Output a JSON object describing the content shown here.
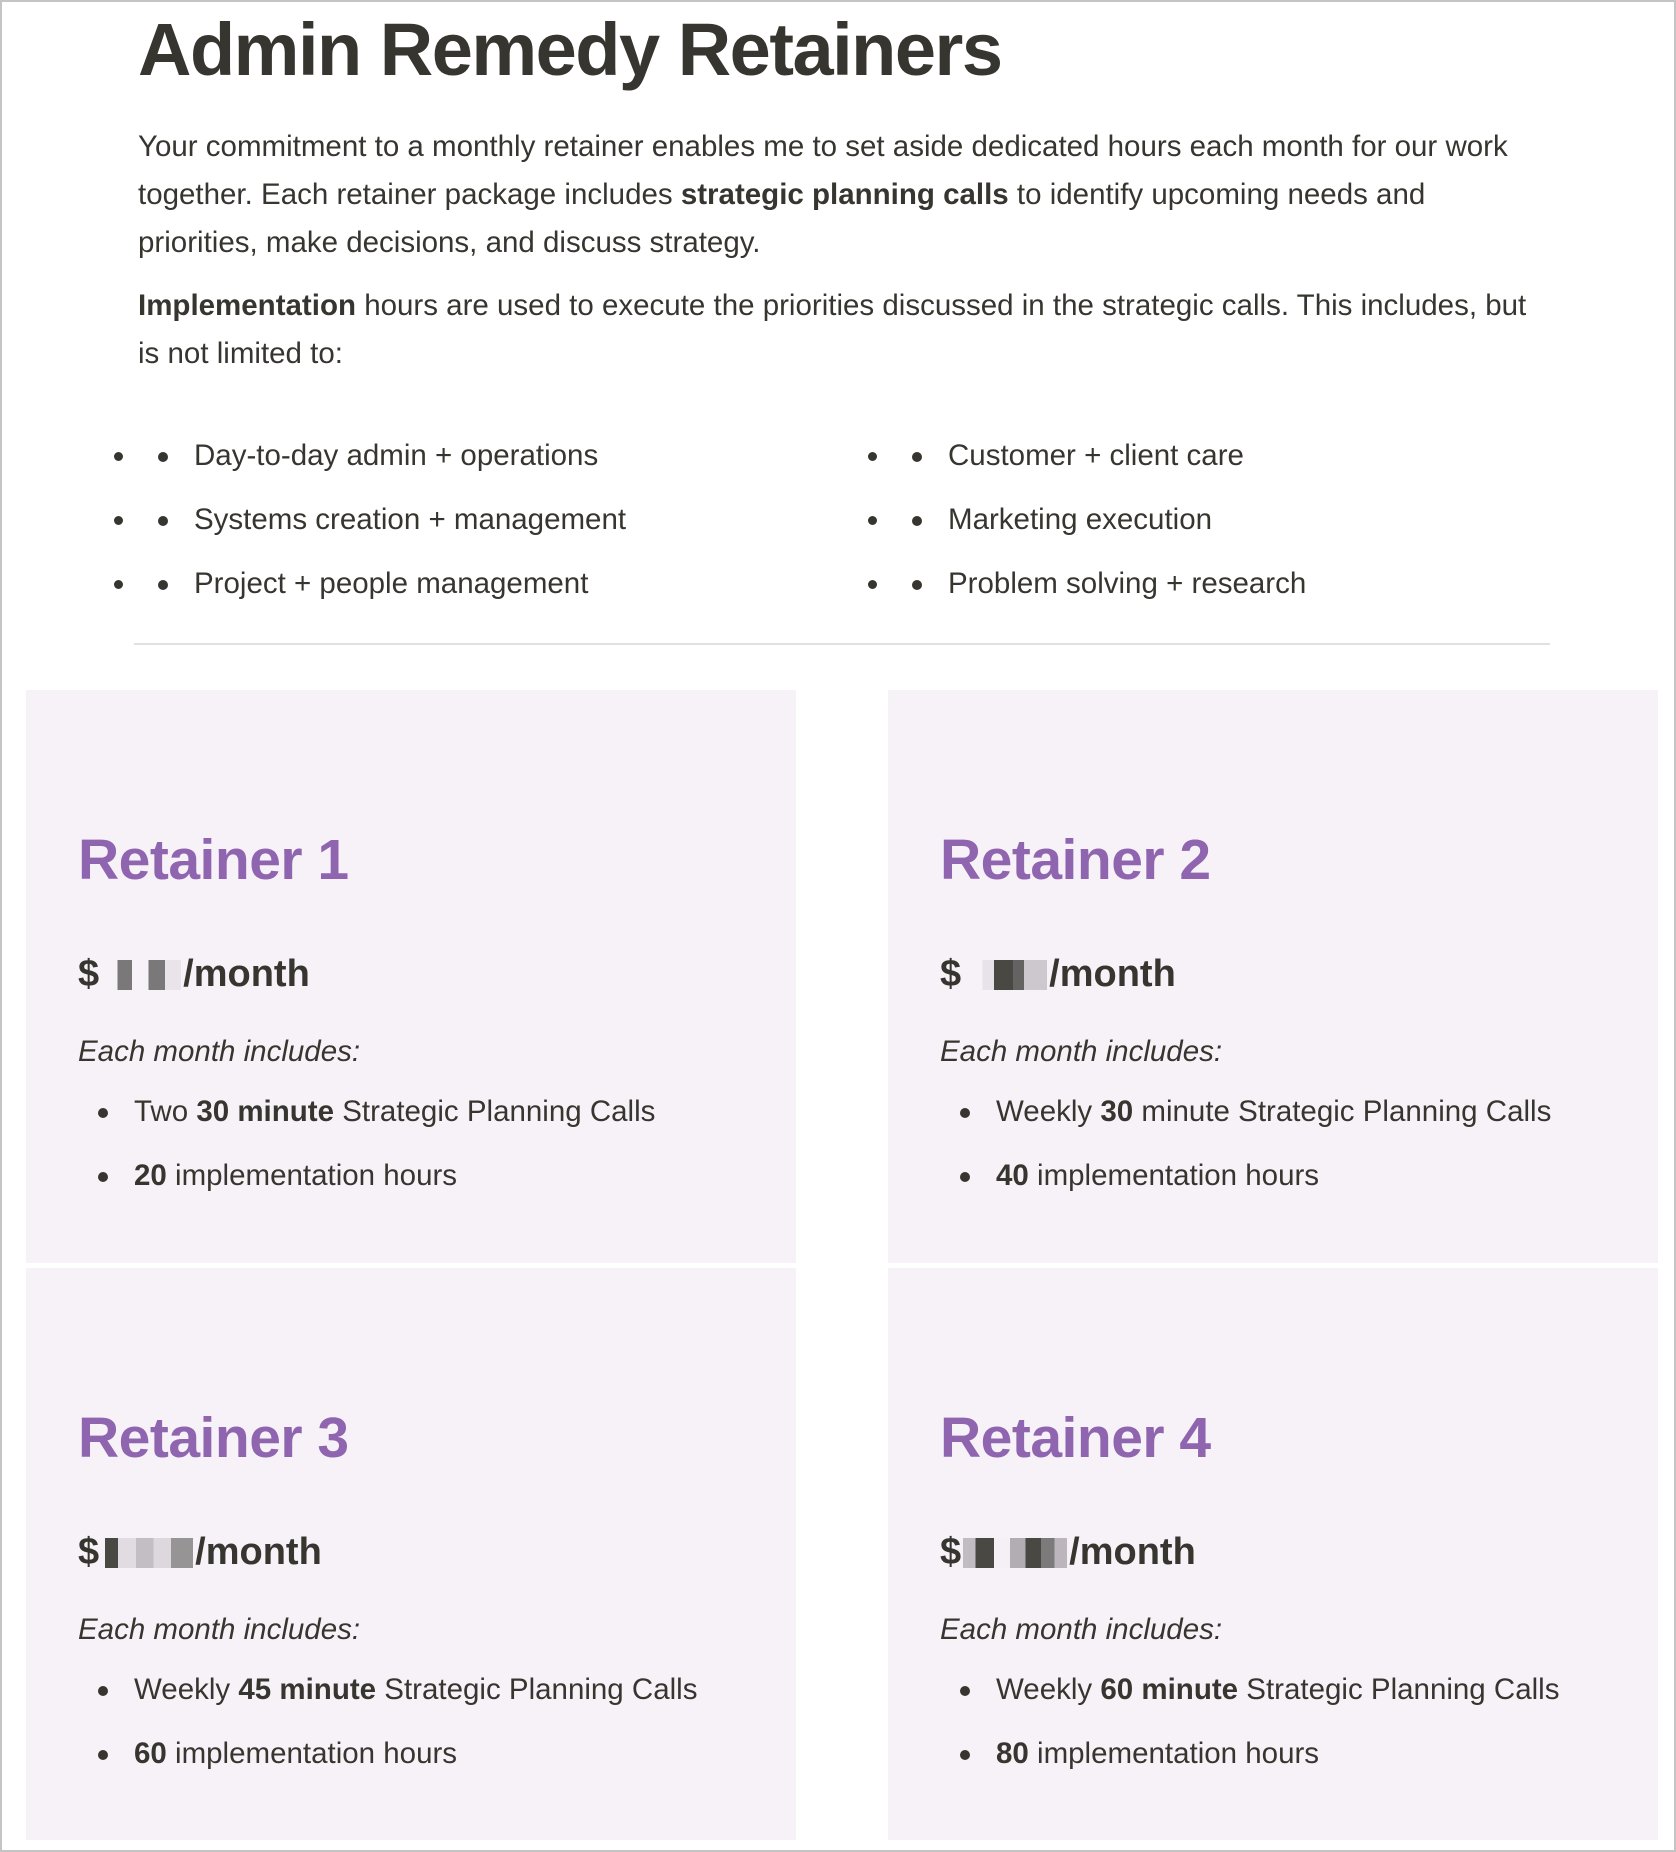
{
  "page": {
    "title": "Admin Remedy Retainers",
    "intro": {
      "p1_before": "Your commitment to a monthly retainer enables me to set aside dedicated hours each month for our work together. Each retainer package includes ",
      "p1_bold": "strategic planning calls",
      "p1_after": " to identify upcoming needs and priorities, make decisions, and discuss strategy.",
      "p2_bold": "Implementation",
      "p2_after": " hours are used to execute the priorities discussed in the strategic calls. This includes, but is not limited to:"
    },
    "services": [
      "Day-to-day admin + operations",
      "Customer + client care",
      "Systems creation + management",
      "Marketing execution",
      "Project + people management",
      "Problem solving + research"
    ]
  },
  "colors": {
    "accent": "#9065b0",
    "card_background": "#f7f2f8",
    "text": "#37352f"
  },
  "retainers": [
    {
      "title": "Retainer 1",
      "currency": "$",
      "price_redacted": true,
      "period": "/month",
      "includes_label": "Each month includes:",
      "calls": {
        "prefix": "Two ",
        "bold": "30 minute",
        "suffix": " Strategic Planning Calls"
      },
      "hours": {
        "bold": "20",
        "suffix": " implementation hours"
      }
    },
    {
      "title": "Retainer 2",
      "currency": "$",
      "price_redacted": true,
      "period": "/month",
      "includes_label": "Each month includes:",
      "calls": {
        "prefix": "Weekly ",
        "bold": "30",
        "suffix": " minute Strategic Planning Calls"
      },
      "hours": {
        "bold": "40",
        "suffix": " implementation hours"
      }
    },
    {
      "title": "Retainer 3",
      "currency": "$",
      "price_redacted": true,
      "period": "/month",
      "includes_label": "Each month includes:",
      "calls": {
        "prefix": "Weekly ",
        "bold": "45 minute",
        "suffix": " Strategic Planning Calls"
      },
      "hours": {
        "bold": "60",
        "suffix": " implementation hours"
      }
    },
    {
      "title": "Retainer 4",
      "currency": "$",
      "price_redacted": true,
      "period": "/month",
      "includes_label": "Each month includes:",
      "calls": {
        "prefix": "Weekly ",
        "bold": "60 minute",
        "suffix": " Strategic Planning Calls"
      },
      "hours": {
        "bold": "80",
        "suffix": " implementation hours"
      }
    }
  ]
}
